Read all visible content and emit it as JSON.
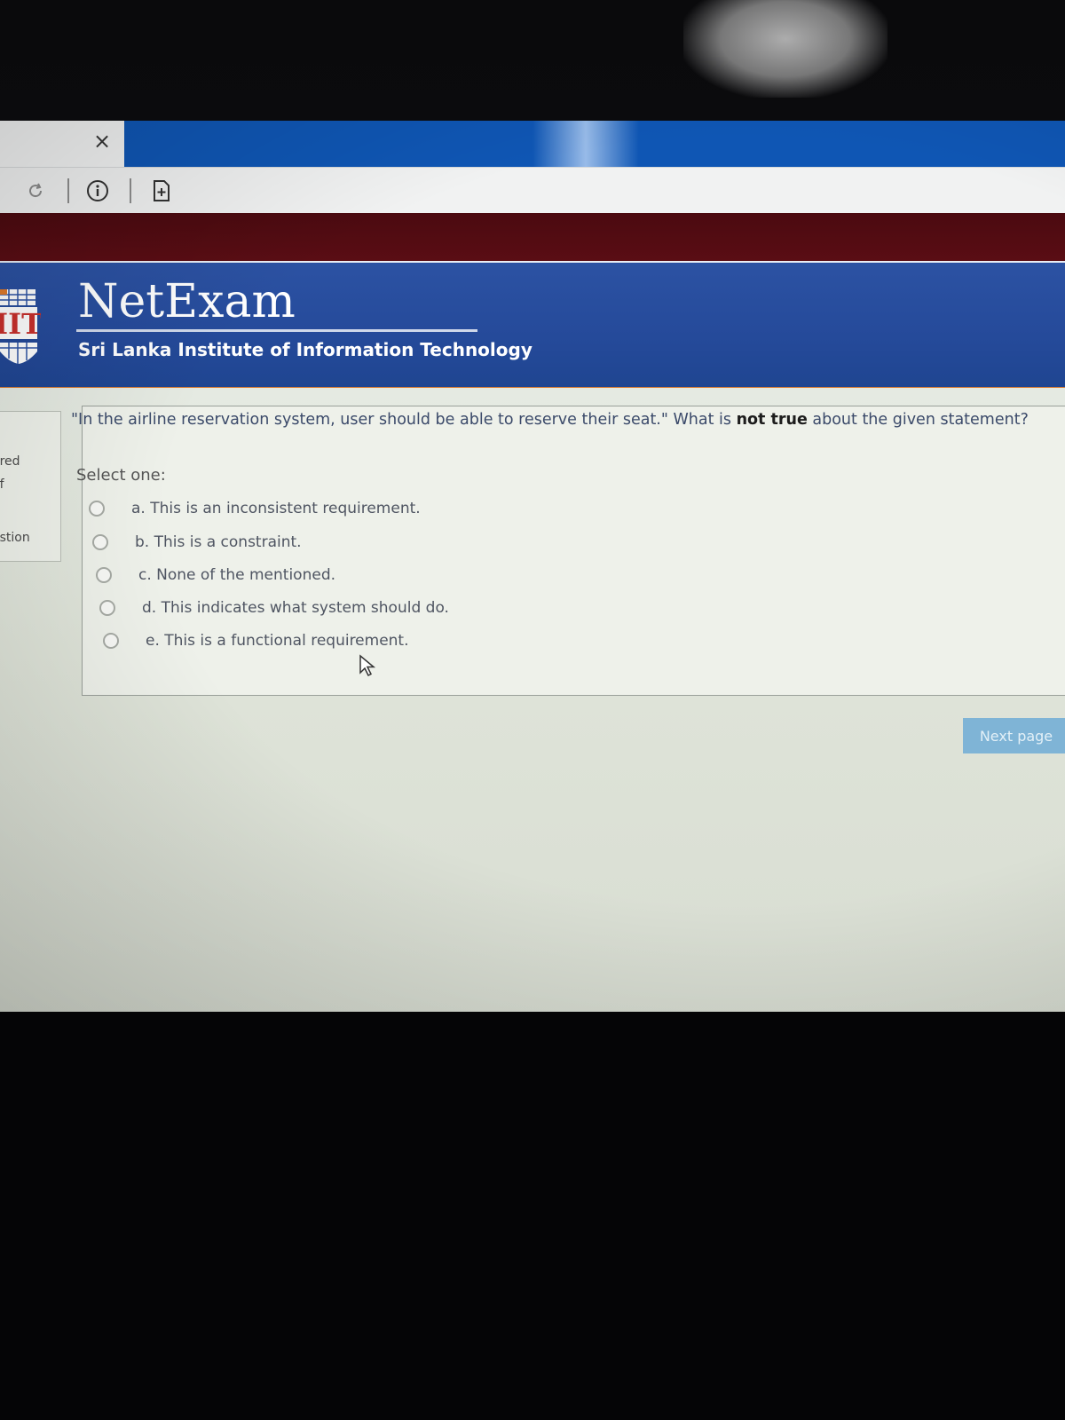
{
  "browser": {
    "tab_close_glyph": "×"
  },
  "toolbar": {
    "icons": [
      "refresh-icon",
      "info-icon",
      "add-page-icon"
    ]
  },
  "header": {
    "title": "NetExam",
    "subtitle": "Sri Lanka Institute of Information Technology",
    "logo_text": "IIT",
    "colors": {
      "band": "#2c52a3",
      "maroon": "#550c12",
      "accent": "#d8782e"
    }
  },
  "nav": {
    "fragments": [
      "ered",
      "of",
      "estion"
    ]
  },
  "question": {
    "text_before": "\"In the airline reservation system, user should be able to reserve their seat.\" What is ",
    "text_strong": "not true",
    "text_after": " about the given statement?",
    "select_label": "Select one:",
    "options": [
      {
        "label": "a. This is an inconsistent requirement.",
        "selected": false
      },
      {
        "label": "b. This is a constraint.",
        "selected": false
      },
      {
        "label": "c. None of the mentioned.",
        "selected": false
      },
      {
        "label": "d. This indicates what system should do.",
        "selected": false
      },
      {
        "label": "e. This is a functional requirement.",
        "selected": false
      }
    ]
  },
  "actions": {
    "next_label": "Next page",
    "next_color": "#7fb4d6"
  }
}
